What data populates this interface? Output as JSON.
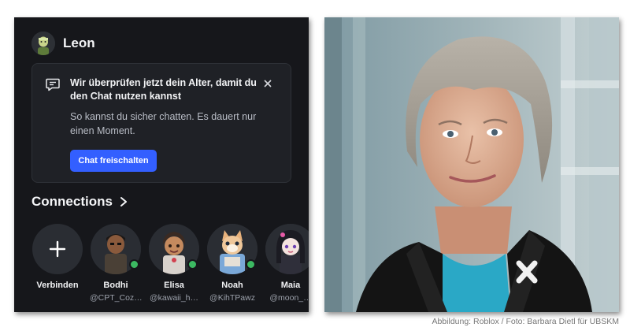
{
  "app": {
    "username": "Leon",
    "notice": {
      "title": "Wir überprüfen jetzt dein Alter, damit du den Chat nutzen kannst",
      "body": "So kannst du sicher chatten. Es dauert nur einen Moment.",
      "cta_label": "Chat freischalten"
    },
    "connections_label": "Connections",
    "friends": [
      {
        "name": "Verbinden",
        "handle": "",
        "icon": "plus-icon",
        "online": false
      },
      {
        "name": "Bodhi",
        "handle": "@CPT_Coz…",
        "online": true
      },
      {
        "name": "Elisa",
        "handle": "@kawaii_h…",
        "online": true
      },
      {
        "name": "Noah",
        "handle": "@KihTPawz",
        "online": true
      },
      {
        "name": "Maia",
        "handle": "@moon_…",
        "online": false
      }
    ],
    "colors": {
      "background": "#16171b",
      "card": "#1f2126",
      "accent": "#335fff",
      "online": "#3cb962"
    }
  },
  "caption": "Abbildung: Roblox / Foto: Barbara Dietl für UBSKM"
}
